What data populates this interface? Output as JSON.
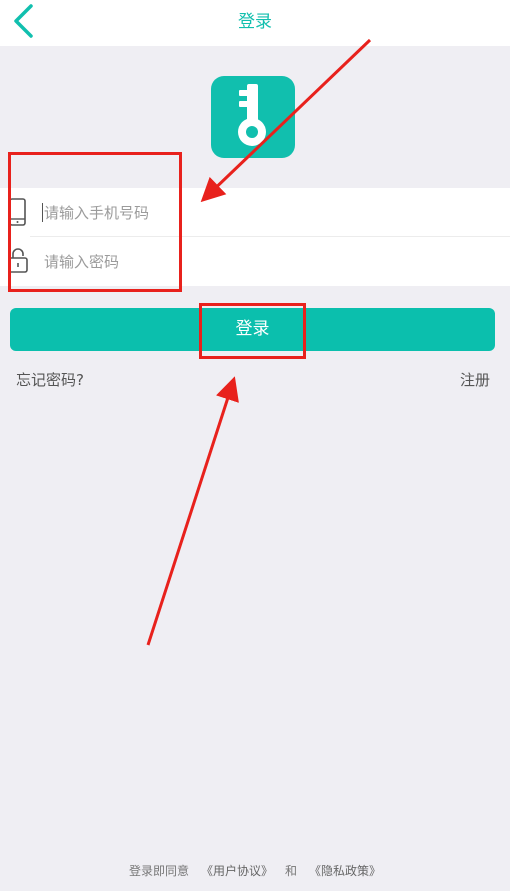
{
  "header": {
    "title": "登录",
    "back_icon": "chevron-left-icon"
  },
  "logo": {
    "icon": "key-icon",
    "color": "#11bfae"
  },
  "form": {
    "phone": {
      "icon": "phone-icon",
      "placeholder": "请输入手机号码",
      "value": ""
    },
    "password": {
      "icon": "lock-icon",
      "placeholder": "请输入密码",
      "value": ""
    }
  },
  "actions": {
    "login_label": "登录",
    "forgot_label": "忘记密码?",
    "register_label": "注册"
  },
  "footer": {
    "prefix": "登录即同意",
    "user_agreement": "《用户协议》",
    "and": "和",
    "privacy_policy": "《隐私政策》"
  },
  "colors": {
    "accent": "#11bfae",
    "background": "#efeef3",
    "annotation": "#e8211c"
  }
}
